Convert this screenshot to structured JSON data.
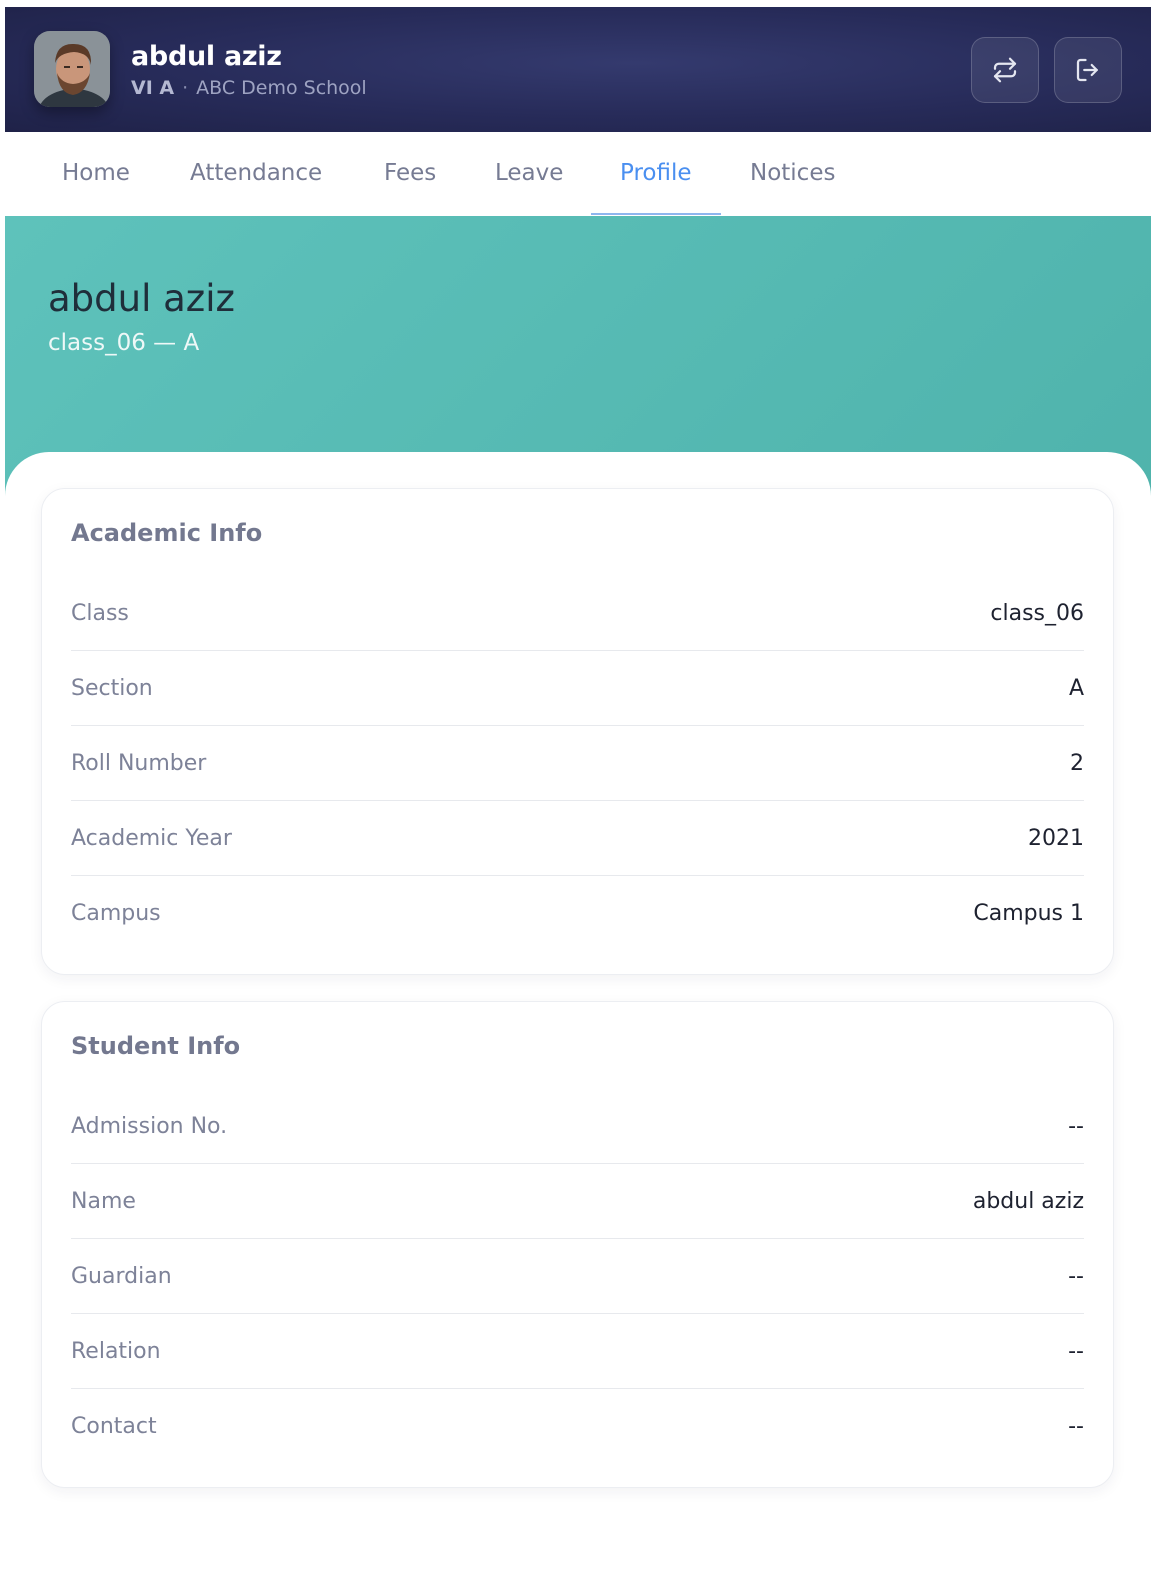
{
  "header": {
    "name": "abdul aziz",
    "class_label": "VI A",
    "separator": "·",
    "school": "ABC Demo School"
  },
  "nav": {
    "tabs": [
      {
        "label": "Home"
      },
      {
        "label": "Attendance"
      },
      {
        "label": "Fees"
      },
      {
        "label": "Leave"
      },
      {
        "label": "Profile"
      },
      {
        "label": "Notices"
      }
    ],
    "active": "Profile"
  },
  "banner": {
    "name": "abdul aziz",
    "subtitle": "class_06 — A"
  },
  "academic": {
    "title": "Academic Info",
    "rows": [
      {
        "label": "Class",
        "value": "class_06"
      },
      {
        "label": "Section",
        "value": "A"
      },
      {
        "label": "Roll Number",
        "value": "2"
      },
      {
        "label": "Academic Year",
        "value": "2021"
      },
      {
        "label": "Campus",
        "value": "Campus 1"
      }
    ]
  },
  "student": {
    "title": "Student Info",
    "rows": [
      {
        "label": "Admission No.",
        "value": "--"
      },
      {
        "label": "Name",
        "value": "abdul aziz"
      },
      {
        "label": "Guardian",
        "value": "--"
      },
      {
        "label": "Relation",
        "value": "--"
      },
      {
        "label": "Contact",
        "value": "--"
      }
    ]
  },
  "icons": {
    "switch": "switch-arrows-icon",
    "logout": "logout-icon"
  },
  "colors": {
    "header_bg": "#272b59",
    "accent": "#4a8ff0",
    "banner_bg": "#56bab3"
  }
}
